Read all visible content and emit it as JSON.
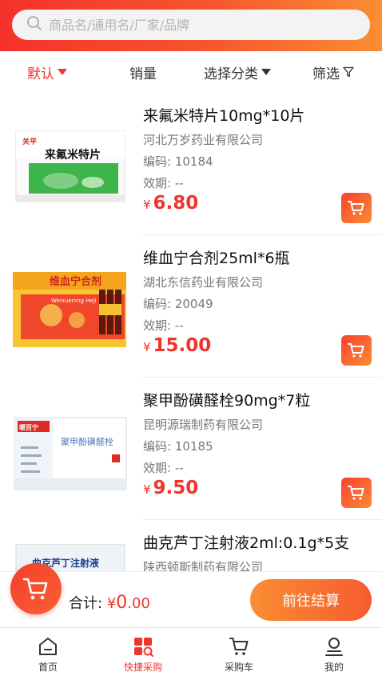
{
  "search": {
    "placeholder": "商品名/通用名/厂家/品牌",
    "icon": "search-icon"
  },
  "filters": [
    {
      "label": "默认",
      "active": true
    },
    {
      "label": "销量",
      "active": false
    },
    {
      "label": "选择分类",
      "active": false
    },
    {
      "label": "筛选",
      "active": false
    }
  ],
  "products": [
    {
      "name": "来氟米特片10mg*10片",
      "maker": "河北万岁药业有限公司",
      "code": "编码: 10184",
      "expiry": "效期: --",
      "currency": "¥",
      "price": "6.80",
      "image": {
        "brand": "关平",
        "title": "来氟米特片"
      }
    },
    {
      "name": "维血宁合剂25ml*6瓶",
      "maker": "湖北东信药业有限公司",
      "code": "编码: 20049",
      "expiry": "效期: --",
      "currency": "¥",
      "price": "15.00",
      "image": {
        "title": "维血宁合剂",
        "subtitle": "Weixuening Heji"
      }
    },
    {
      "name": "聚甲酚磺醛栓90mg*7粒",
      "maker": "昆明源瑞制药有限公司",
      "code": "编码: 10185",
      "expiry": "效期: --",
      "currency": "¥",
      "price": "9.50",
      "image": {
        "brand": "暖百宁",
        "title": "聚甲酚磺醛栓"
      }
    },
    {
      "name": "曲克芦丁注射液2ml:0.1g*5支",
      "maker": "陕西顿斯制药有限公司",
      "code": "",
      "expiry": "",
      "currency": "¥",
      "price": "",
      "image": {
        "title": "曲克芦丁注射液"
      }
    }
  ],
  "checkout": {
    "total_label": "合计:",
    "currency": "¥",
    "total_int": "0",
    "total_dec": ".00",
    "button": "前往结算"
  },
  "tabs": [
    {
      "label": "首页",
      "icon": "home-icon",
      "active": false
    },
    {
      "label": "快捷采购",
      "icon": "quick-purchase-icon",
      "active": true
    },
    {
      "label": "采购车",
      "icon": "cart-icon",
      "active": false
    },
    {
      "label": "我的",
      "icon": "profile-icon",
      "active": false
    }
  ],
  "colors": {
    "accent": "#f0342c",
    "gradient_start": "#f5312b",
    "gradient_end": "#fb8d33"
  }
}
